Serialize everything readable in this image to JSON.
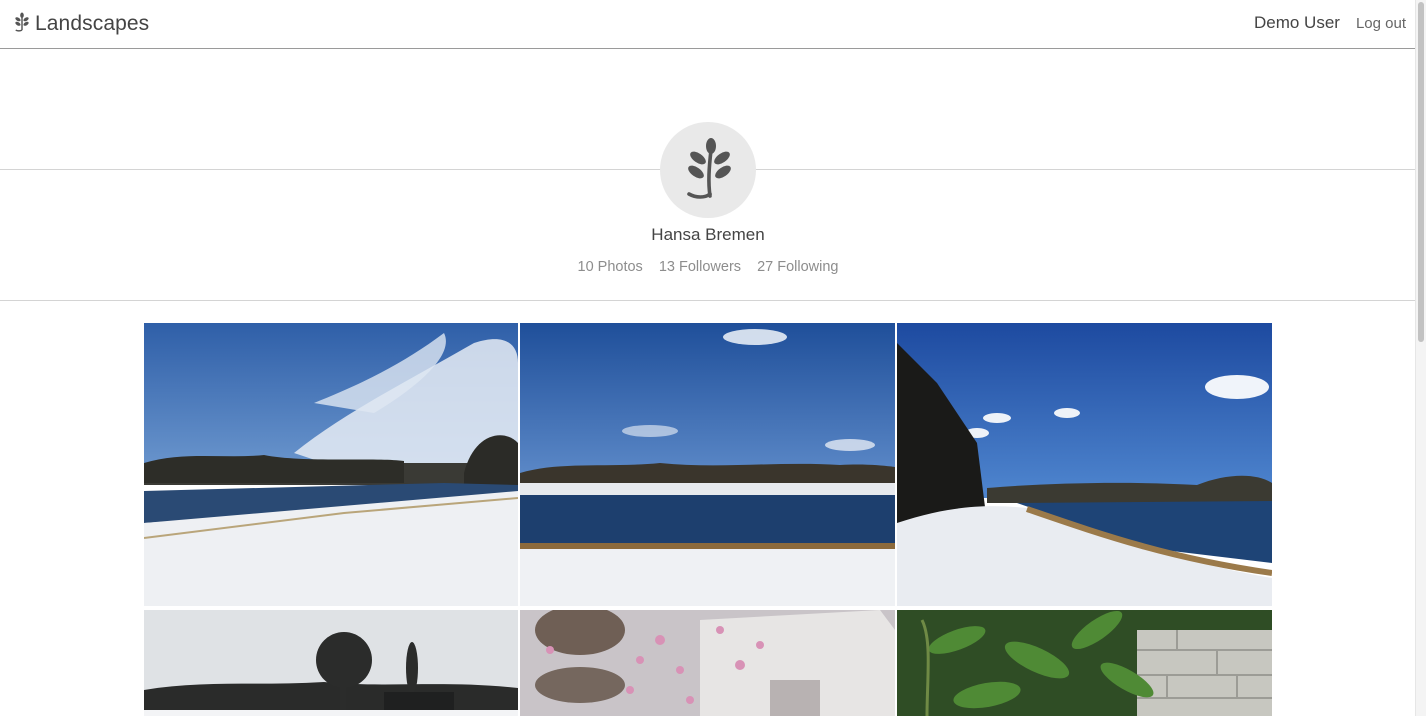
{
  "navbar": {
    "brand": "Landscapes",
    "user": "Demo User",
    "logout": "Log out"
  },
  "profile": {
    "name": "Hansa Bremen",
    "stats": {
      "photos": "10 Photos",
      "followers": "13 Followers",
      "following": "27 Following"
    }
  },
  "icons": {
    "brand": "leaf-branch-icon",
    "avatar": "leaf-branch-icon"
  },
  "colors": {
    "text": "#444444",
    "muted": "#8d8d8d",
    "avatar_bg": "#e9e9e9",
    "icon": "#555555"
  }
}
